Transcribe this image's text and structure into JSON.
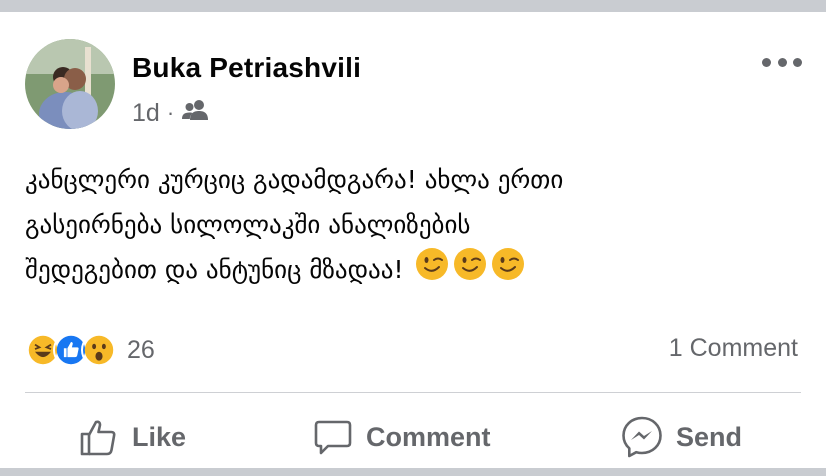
{
  "post": {
    "author": "Buka Petriashvili",
    "time": "1d",
    "separator": "·",
    "audience_icon": "friends-icon",
    "text_lines": [
      "კანცლერი კურციც გადამდგარა! ახლა ერთი",
      "გასეირნება სილოლაკში ანალიზების",
      "შედეგებით და ანტუნიც მზადაა!"
    ],
    "emojis": [
      "winking-face-icon",
      "winking-face-icon",
      "winking-face-icon"
    ]
  },
  "reactions": {
    "icons": [
      "haha-reaction-icon",
      "like-reaction-icon",
      "wow-reaction-icon"
    ],
    "count": "26"
  },
  "comments": {
    "count_label": "1 Comment"
  },
  "actions": {
    "like_label": "Like",
    "comment_label": "Comment",
    "send_label": "Send"
  },
  "colors": {
    "text": "#050505",
    "secondary": "#65676b",
    "like_blue": "#1877f2",
    "emoji_yellow": "#f7b928"
  }
}
